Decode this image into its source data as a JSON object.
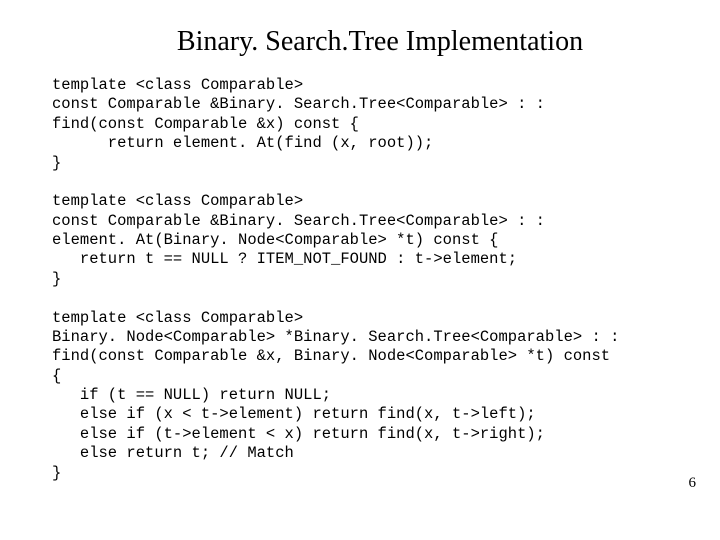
{
  "title": "Binary. Search.Tree Implementation",
  "code_lines": [
    "template <class Comparable>",
    "const Comparable &Binary. Search.Tree<Comparable> : :",
    "find(const Comparable &x) const {",
    "      return element. At(find (x, root));",
    "}",
    "",
    "template <class Comparable>",
    "const Comparable &Binary. Search.Tree<Comparable> : :",
    "element. At(Binary. Node<Comparable> *t) const {",
    "   return t == NULL ? ITEM_NOT_FOUND : t->element;",
    "}",
    "",
    "template <class Comparable>",
    "Binary. Node<Comparable> *Binary. Search.Tree<Comparable> : :",
    "find(const Comparable &x, Binary. Node<Comparable> *t) const",
    "{",
    "   if (t == NULL) return NULL;",
    "   else if (x < t->element) return find(x, t->left);",
    "   else if (t->element < x) return find(x, t->right);",
    "   else return t; // Match",
    "}"
  ],
  "page_number": "6"
}
